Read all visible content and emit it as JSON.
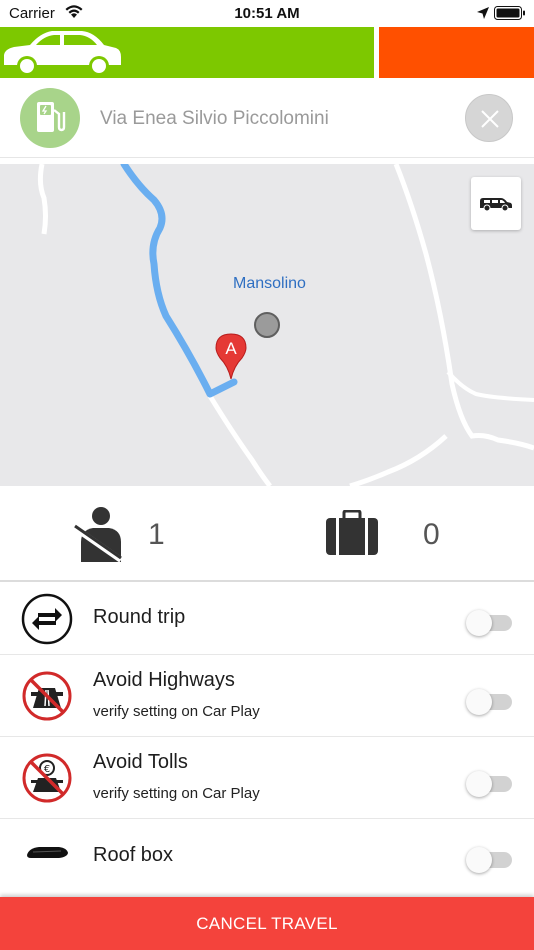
{
  "status_bar": {
    "carrier": "Carrier",
    "time": "10:51 AM"
  },
  "vehicle_bar": {
    "primary_color": "#7dc800",
    "secondary_color": "#ff5000",
    "icon": "car-icon"
  },
  "destination": {
    "icon": "fuel-station-icon",
    "value": "Via Enea Silvio Piccolomini",
    "clear_icon": "close-icon"
  },
  "map": {
    "place_label": "Mansolino",
    "pin_label": "A",
    "route_color": "#6aaef0",
    "vehicle_type_icon": "van-icon"
  },
  "counts": {
    "passengers": "1",
    "luggage": "0",
    "passenger_icon": "seatbelt-icon",
    "luggage_icon": "suitcase-icon"
  },
  "options": [
    {
      "title": "Round trip",
      "subtitle": "",
      "icon": "round-trip-icon",
      "enabled": false
    },
    {
      "title": "Avoid Highways",
      "subtitle": "verify setting on Car Play",
      "icon": "no-highway-icon",
      "enabled": false
    },
    {
      "title": "Avoid Tolls",
      "subtitle": "verify setting on Car Play",
      "icon": "no-toll-icon",
      "enabled": false
    },
    {
      "title": "Roof box",
      "subtitle": "",
      "icon": "roof-box-icon",
      "enabled": false
    }
  ],
  "cancel_button": {
    "label": "CANCEL TRAVEL",
    "color": "#f4433c"
  }
}
